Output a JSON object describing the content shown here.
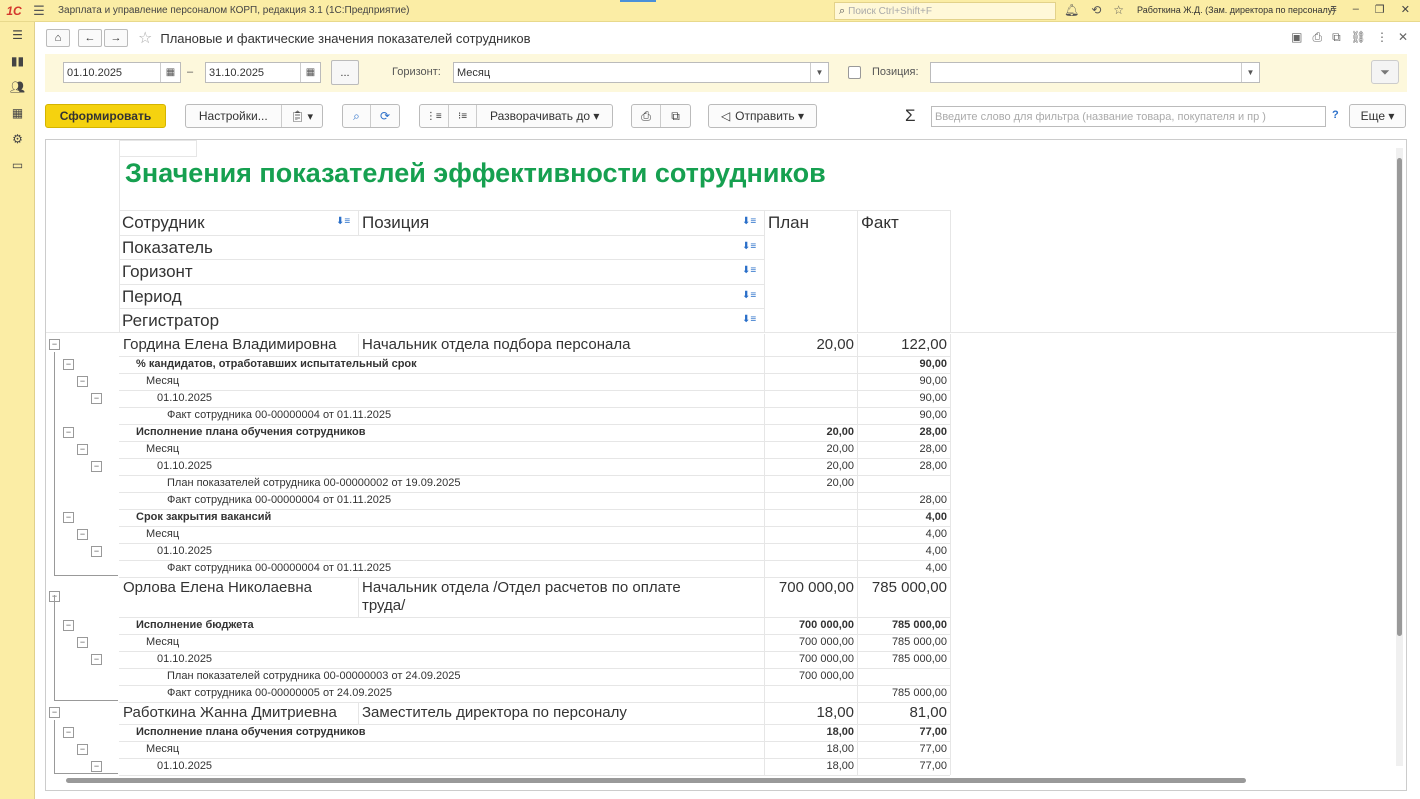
{
  "app": {
    "logo": "1С",
    "title": "Зарплата и управление персоналом КОРП, редакция 3.1  (1С:Предприятие)",
    "search_placeholder": "Поиск Ctrl+Shift+F",
    "user": "Работкина Ж.Д. (Зам. директора по персоналу)"
  },
  "form": {
    "title": "Плановые и фактические значения показателей сотрудников"
  },
  "filters": {
    "date_from": "01.10.2025",
    "dash": "–",
    "date_to": "31.10.2025",
    "dots_label": "...",
    "horizon_label": "Горизонт:",
    "horizon_value": "Месяц",
    "position_label": "Позиция:",
    "position_value": ""
  },
  "toolbar": {
    "generate": "Сформировать",
    "settings": "Настройки...",
    "expand": "Разворачивать до",
    "send": "Отправить",
    "filter_placeholder": "Введите слово для фильтра (название товара, покупателя и пр )",
    "help": "?",
    "more": "Еще"
  },
  "report": {
    "title": "Значения показателей эффективности сотрудников",
    "headers": {
      "employee": "Сотрудник",
      "position": "Позиция",
      "plan": "План",
      "fact": "Факт",
      "indicator": "Показатель",
      "horizon": "Горизонт",
      "period": "Период",
      "registrar": "Регистратор"
    },
    "rows": [
      {
        "type": "emp",
        "name": "Гордина Елена Владимировна",
        "position": "Начальник отдела подбора персонала",
        "plan": "20,00",
        "fact": "122,00"
      },
      {
        "type": "ind",
        "name": "% кандидатов, отработавших испытательный срок",
        "plan": "",
        "fact": "90,00"
      },
      {
        "type": "hor",
        "name": "Месяц",
        "plan": "",
        "fact": "90,00"
      },
      {
        "type": "per",
        "name": "01.10.2025",
        "plan": "",
        "fact": "90,00"
      },
      {
        "type": "reg",
        "name": "Факт сотрудника 00-00000004 от 01.11.2025",
        "plan": "",
        "fact": "90,00"
      },
      {
        "type": "ind",
        "name": "Исполнение плана обучения сотрудников",
        "plan": "20,00",
        "fact": "28,00"
      },
      {
        "type": "hor",
        "name": "Месяц",
        "plan": "20,00",
        "fact": "28,00"
      },
      {
        "type": "per",
        "name": "01.10.2025",
        "plan": "20,00",
        "fact": "28,00"
      },
      {
        "type": "reg",
        "name": "План показателей сотрудника 00-00000002 от 19.09.2025",
        "plan": "20,00",
        "fact": ""
      },
      {
        "type": "reg",
        "name": "Факт сотрудника 00-00000004 от 01.11.2025",
        "plan": "",
        "fact": "28,00"
      },
      {
        "type": "ind",
        "name": "Срок закрытия вакансий",
        "plan": "",
        "fact": "4,00"
      },
      {
        "type": "hor",
        "name": "Месяц",
        "plan": "",
        "fact": "4,00"
      },
      {
        "type": "per",
        "name": "01.10.2025",
        "plan": "",
        "fact": "4,00"
      },
      {
        "type": "reg",
        "name": "Факт сотрудника 00-00000004 от 01.11.2025",
        "plan": "",
        "fact": "4,00"
      },
      {
        "type": "emp2",
        "name": "Орлова Елена Николаевна",
        "position": "Начальник отдела /Отдел расчетов по оплате",
        "position2": "труда/",
        "plan": "700 000,00",
        "fact": "785 000,00"
      },
      {
        "type": "ind",
        "name": "Исполнение бюджета",
        "plan": "700 000,00",
        "fact": "785 000,00"
      },
      {
        "type": "hor",
        "name": "Месяц",
        "plan": "700 000,00",
        "fact": "785 000,00"
      },
      {
        "type": "per",
        "name": "01.10.2025",
        "plan": "700 000,00",
        "fact": "785 000,00"
      },
      {
        "type": "reg",
        "name": "План показателей сотрудника 00-00000003 от 24.09.2025",
        "plan": "700 000,00",
        "fact": ""
      },
      {
        "type": "reg",
        "name": "Факт сотрудника 00-00000005 от 24.09.2025",
        "plan": "",
        "fact": "785 000,00"
      },
      {
        "type": "emp",
        "name": "Работкина Жанна Дмитриевна",
        "position": "Заместитель директора по персоналу",
        "plan": "18,00",
        "fact": "81,00"
      },
      {
        "type": "ind",
        "name": "Исполнение плана обучения сотрудников",
        "plan": "18,00",
        "fact": "77,00"
      },
      {
        "type": "hor",
        "name": "Месяц",
        "plan": "18,00",
        "fact": "77,00"
      },
      {
        "type": "per",
        "name": "01.10.2025",
        "plan": "18,00",
        "fact": "77,00"
      }
    ]
  }
}
